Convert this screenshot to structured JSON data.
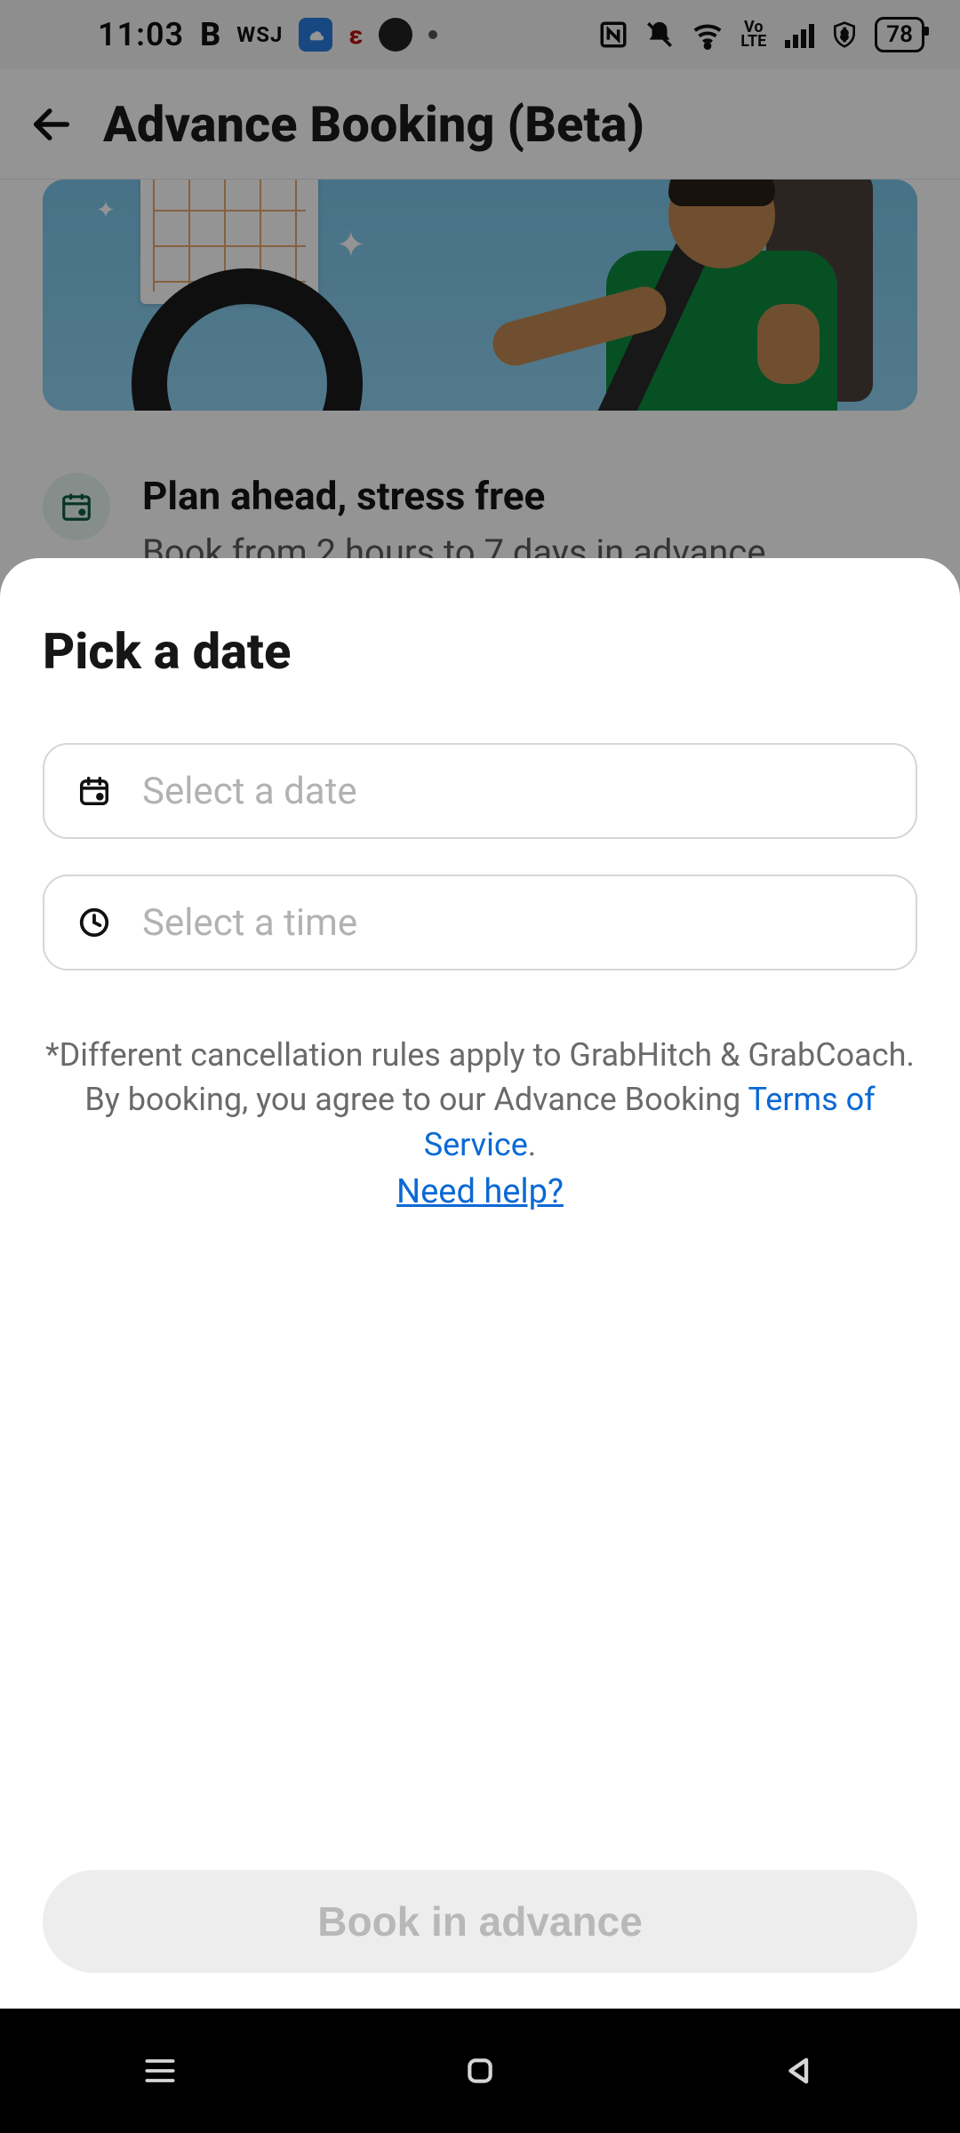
{
  "status": {
    "time": "11:03",
    "icons": [
      "B",
      "WSJ",
      "weather",
      "evernote",
      "app",
      "dot"
    ],
    "battery": "78"
  },
  "header": {
    "title": "Advance Booking (Beta)"
  },
  "info": {
    "title": "Plan ahead, stress free",
    "subtitle": "Book from 2 hours to 7 days in advance."
  },
  "sheet": {
    "title": "Pick a date",
    "date_placeholder": "Select a date",
    "time_placeholder": "Select a time",
    "disclaimer_line1": "*Different cancellation rules apply to GrabHitch & GrabCoach.",
    "disclaimer_line2_prefix": "By booking, you agree to our Advance Booking ",
    "terms_link": "Terms of Service",
    "period": ".",
    "help_link": "Need help?",
    "cta": "Book in advance"
  }
}
